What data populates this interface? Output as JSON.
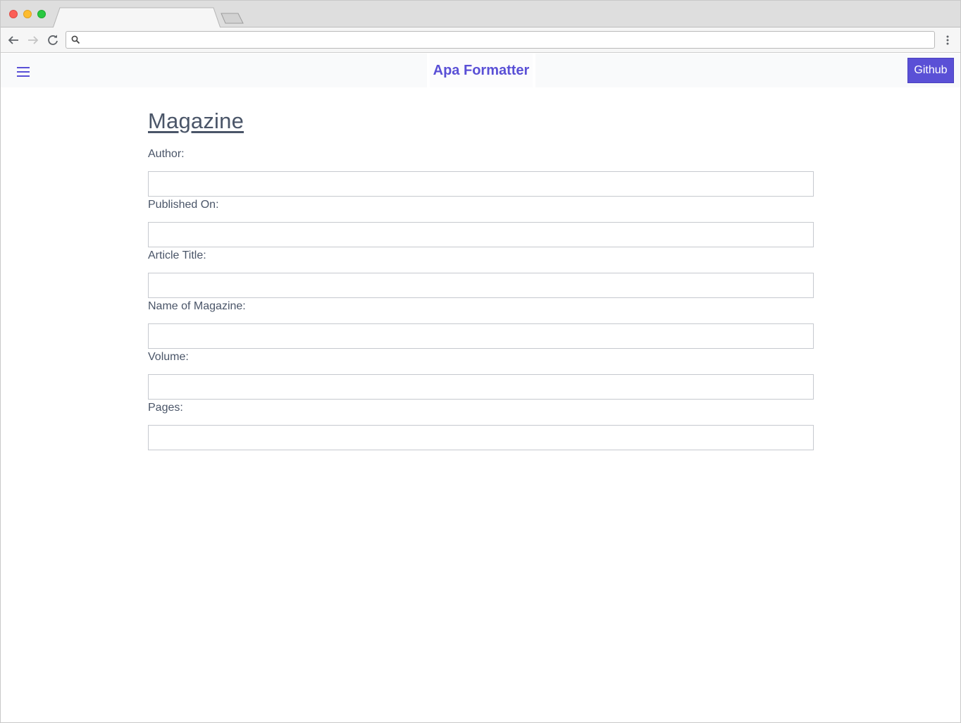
{
  "browser": {
    "tab_title": "",
    "address": "",
    "icons": {
      "back": "arrow-left-icon",
      "forward": "arrow-right-icon",
      "reload": "reload-icon",
      "search": "search-icon",
      "menu": "kebab-menu-icon"
    }
  },
  "header": {
    "brand": "Apa Formatter",
    "github_label": "Github",
    "menu_icon": "hamburger-icon",
    "colors": {
      "accent": "#5a50d6",
      "header_bg": "#f9fafb"
    }
  },
  "main": {
    "title": "Magazine",
    "fields": [
      {
        "label": "Author:",
        "value": ""
      },
      {
        "label": "Published On:",
        "value": ""
      },
      {
        "label": "Article Title:",
        "value": ""
      },
      {
        "label": "Name of Magazine:",
        "value": ""
      },
      {
        "label": "Volume:",
        "value": ""
      },
      {
        "label": "Pages:",
        "value": ""
      }
    ]
  }
}
